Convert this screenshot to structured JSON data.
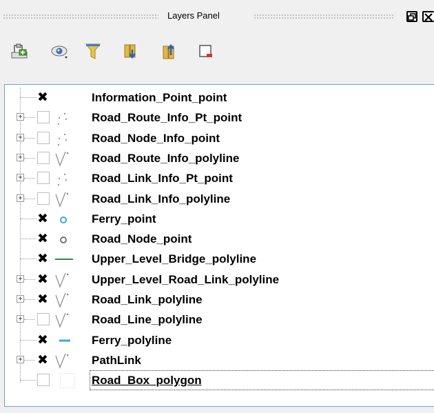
{
  "panel": {
    "title": "Layers Panel"
  },
  "toolbar": {
    "tools": [
      {
        "name": "add-group-icon"
      },
      {
        "name": "visibility-icon"
      },
      {
        "name": "filter-icon"
      },
      {
        "name": "expand-all-icon"
      },
      {
        "name": "collapse-all-icon"
      },
      {
        "name": "remove-layer-icon"
      }
    ]
  },
  "layers": [
    {
      "label": "Information_Point_point",
      "checked": true,
      "expandable": false,
      "symbol": "none"
    },
    {
      "label": "Road_Route_Info_Pt_point",
      "checked": false,
      "expandable": true,
      "symbol": "point-scatter"
    },
    {
      "label": "Road_Node_Info_point",
      "checked": false,
      "expandable": true,
      "symbol": "point-scatter"
    },
    {
      "label": "Road_Route_Info_polyline",
      "checked": false,
      "expandable": true,
      "symbol": "line-categorized"
    },
    {
      "label": "Road_Link_Info_Pt_point",
      "checked": false,
      "expandable": true,
      "symbol": "point-scatter"
    },
    {
      "label": "Road_Link_Info_polyline",
      "checked": false,
      "expandable": true,
      "symbol": "line-categorized"
    },
    {
      "label": "Ferry_point",
      "checked": true,
      "expandable": false,
      "symbol": "circle-blue"
    },
    {
      "label": "Road_Node_point",
      "checked": true,
      "expandable": false,
      "symbol": "circle-gray"
    },
    {
      "label": "Upper_Level_Bridge_polyline",
      "checked": true,
      "expandable": false,
      "symbol": "line-green"
    },
    {
      "label": "Upper_Level_Road_Link_polyline",
      "checked": true,
      "expandable": true,
      "symbol": "line-categorized"
    },
    {
      "label": "Road_Link_polyline",
      "checked": true,
      "expandable": true,
      "symbol": "line-categorized"
    },
    {
      "label": "Road_Line_polyline",
      "checked": false,
      "expandable": true,
      "symbol": "line-categorized"
    },
    {
      "label": "Ferry_polyline",
      "checked": true,
      "expandable": false,
      "symbol": "line-blue"
    },
    {
      "label": "PathLink",
      "checked": true,
      "expandable": true,
      "symbol": "line-categorized"
    },
    {
      "label": "Road_Box_polygon",
      "checked": false,
      "expandable": false,
      "symbol": "polygon-blank",
      "selected": true
    }
  ],
  "colors": {
    "accent": "#6e9fd8",
    "point_blue": "#3aa6dd",
    "line_green": "#2e8b57",
    "line_blue": "#3aa6dd"
  }
}
